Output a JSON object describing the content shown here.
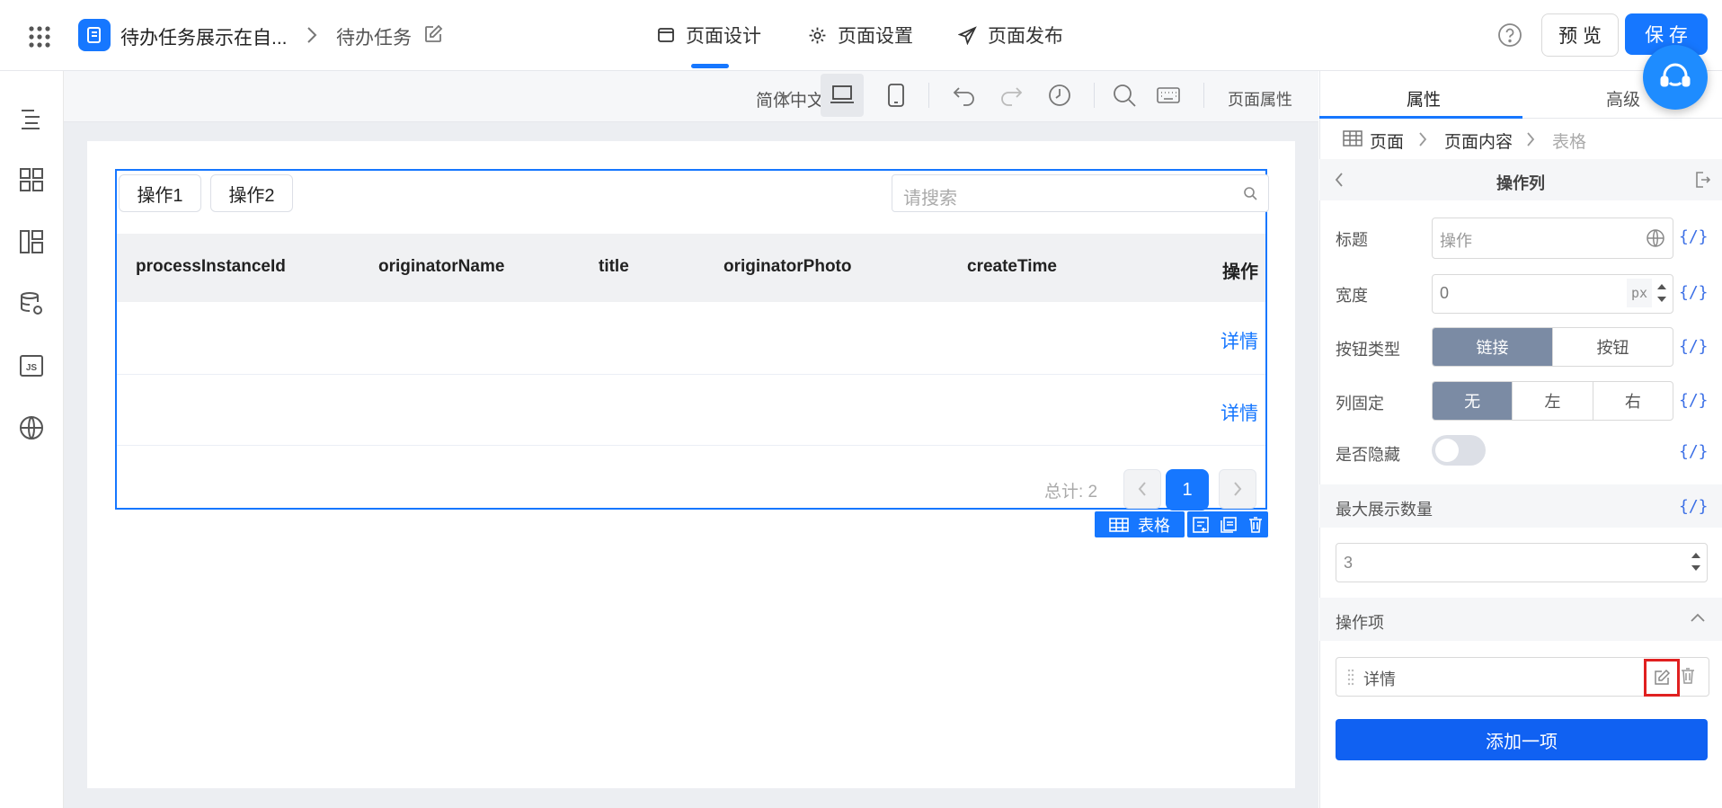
{
  "header": {
    "app_title": "待办任务展示在自...",
    "page_name": "待办任务",
    "tabs": [
      {
        "label": "页面设计"
      },
      {
        "label": "页面设置"
      },
      {
        "label": "页面发布"
      }
    ],
    "preview_label": "预 览",
    "save_label": "保 存"
  },
  "toolbar": {
    "language": "简体中文",
    "page_props": "页面属性"
  },
  "table": {
    "buttons": [
      "操作1",
      "操作2"
    ],
    "search_placeholder": "请搜索",
    "columns": [
      "processInstanceId",
      "originatorName",
      "title",
      "originatorPhoto",
      "createTime",
      "操作"
    ],
    "rows": [
      {
        "action": "详情"
      },
      {
        "action": "详情"
      }
    ],
    "total_label": "总计: 2",
    "current_page": "1",
    "component_tag": "表格"
  },
  "panel": {
    "tabs": [
      "属性",
      "高级"
    ],
    "breadcrumb": [
      "页面",
      "页面内容",
      "表格"
    ],
    "section_title": "操作列",
    "fields": {
      "title_label": "标题",
      "title_placeholder": "操作",
      "width_label": "宽度",
      "width_value": "0",
      "width_unit": "px",
      "btn_type_label": "按钮类型",
      "btn_type_options": [
        "链接",
        "按钮"
      ],
      "fixed_label": "列固定",
      "fixed_options": [
        "无",
        "左",
        "右"
      ],
      "hidden_label": "是否隐藏",
      "hidden_value": false
    },
    "expr_label": "{/}",
    "max_display_label": "最大展示数量",
    "max_display_value": "3",
    "ops_label": "操作项",
    "ops_items": [
      "详情"
    ],
    "add_item_label": "添加一项"
  },
  "colors": {
    "primary": "#1677ff",
    "segment_active": "#7b8ba4",
    "highlight_box": "#e02020"
  }
}
